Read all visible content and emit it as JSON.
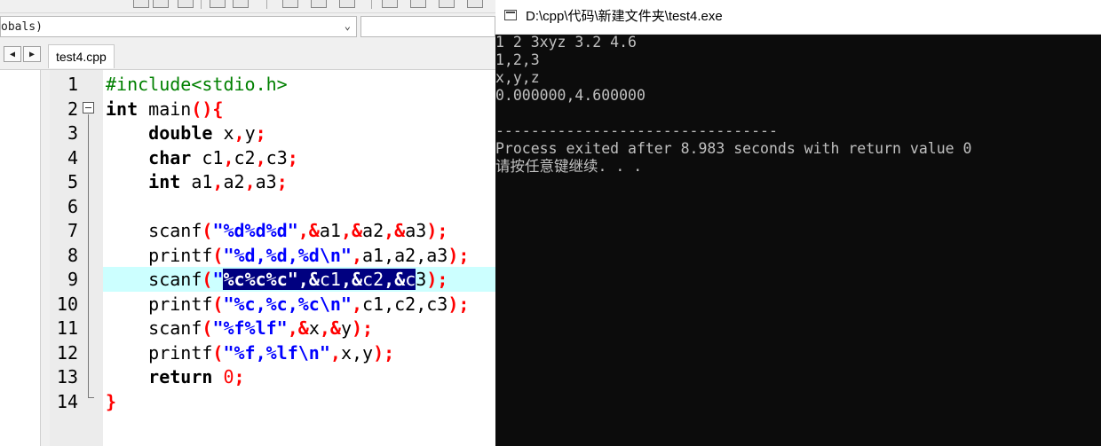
{
  "ide": {
    "scope_value": "obals)",
    "tab_label": "test4.cpp",
    "code_lines": [
      {
        "num": "1"
      },
      {
        "num": "2"
      },
      {
        "num": "3"
      },
      {
        "num": "4"
      },
      {
        "num": "5"
      },
      {
        "num": "6"
      },
      {
        "num": "7"
      },
      {
        "num": "8"
      },
      {
        "num": "9"
      },
      {
        "num": "10"
      },
      {
        "num": "11"
      },
      {
        "num": "12"
      },
      {
        "num": "13"
      },
      {
        "num": "14"
      }
    ],
    "code": {
      "l1": "#include<stdio.h>",
      "l2_kw": "int",
      "l2_rest": " main",
      "l2_op": "(){",
      "l3_kw": "double",
      "l3_rest": " x",
      "l3_c1": ",",
      "l3_rest2": "y",
      "l3_end": ";",
      "l4_kw": "char",
      "l4_a": " c1",
      "l4_b": "c2",
      "l4_c": "c3",
      "l5_kw": "int",
      "l5_a": " a1",
      "l5_b": "a2",
      "l5_c": "a3",
      "l7_fn": "scanf",
      "l7_str": "\"%d%d%d\"",
      "l7_a": "a1",
      "l7_b": "a2",
      "l7_c": "a3",
      "l8_fn": "printf",
      "l8_str": "\"%d,%d,%d\\n\"",
      "l8_args": "a1,a2,a3",
      "l9_fn": "scanf",
      "l9_sel_str": "%c%c%c\"",
      "l9_sel_a": "c1",
      "l9_sel_b": "c2",
      "l9_sel_c": "c",
      "l9_tail": "3",
      "l10_fn": "printf",
      "l10_str": "\"%c,%c,%c\\n\"",
      "l10_args": "c1,c2,c3",
      "l11_fn": "scanf",
      "l11_str": "\"%f%lf\"",
      "l11_a": "x",
      "l11_b": "y",
      "l12_fn": "printf",
      "l12_str": "\"%f,%lf\\n\"",
      "l12_args": "x,y",
      "l13_kw": "return",
      "l13_num": "0",
      "l14": "}"
    }
  },
  "console": {
    "title": "D:\\cpp\\代码\\新建文件夹\\test4.exe",
    "lines": [
      "1 2 3xyz 3.2 4.6",
      "1,2,3",
      "x,y,z",
      "0.000000,4.600000",
      "",
      "--------------------------------",
      "Process exited after 8.983 seconds with return value 0",
      "请按任意键继续. . ."
    ]
  },
  "colors": {
    "console_bg": "#0c0c0c",
    "console_text": "#c0c0c0",
    "highlight_line": "#ccffff",
    "selection": "#000080",
    "string": "#0000ff",
    "operator": "#ff0000",
    "preprocessor": "#008000"
  }
}
